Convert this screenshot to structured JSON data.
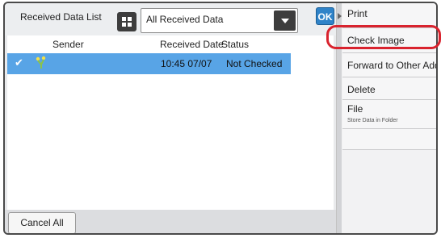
{
  "header": {
    "list_title": "Received Data List",
    "filter_value": "All Received Data",
    "ok_label": "OK"
  },
  "table": {
    "columns": [
      "Sender",
      "Received Date",
      "Status"
    ],
    "rows": [
      {
        "selected": true,
        "sender": "",
        "received_date": "10:45 07/07",
        "status": "Not Checked"
      }
    ]
  },
  "footer": {
    "cancel_label": "Cancel All"
  },
  "actions": {
    "items": [
      {
        "label": "Print"
      },
      {
        "label": "Check Image",
        "highlighted": true
      },
      {
        "label": "Forward to Other Address"
      },
      {
        "label": "Delete"
      },
      {
        "label": "File",
        "sublabel": "Store Data in Folder"
      }
    ]
  },
  "colors": {
    "selected_row": "#58a4e6",
    "ok_button": "#2f83c8",
    "highlight": "#d9232e"
  }
}
